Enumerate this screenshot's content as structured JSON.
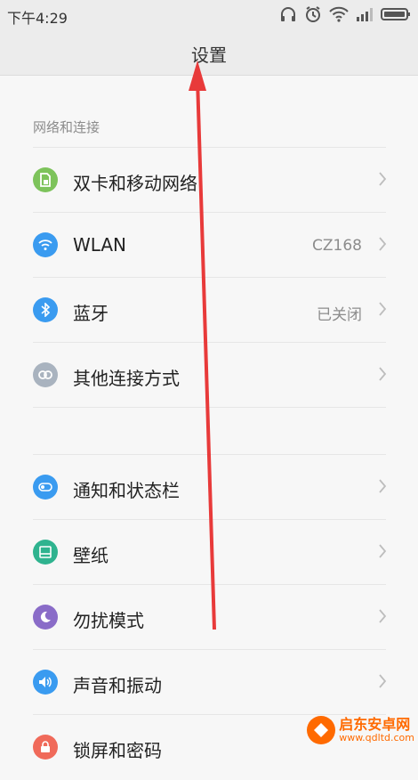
{
  "status_bar": {
    "time": "下午4:29"
  },
  "header": {
    "title": "设置"
  },
  "section_network": {
    "header": "网络和连接",
    "items": [
      {
        "label": "双卡和移动网络",
        "value": "",
        "icon": "sim-icon",
        "color": "#7dc35b"
      },
      {
        "label": "WLAN",
        "value": "CZ168",
        "icon": "wifi-icon",
        "color": "#3a9bf0"
      },
      {
        "label": "蓝牙",
        "value": "已关闭",
        "icon": "bluetooth-icon",
        "color": "#3a9bf0"
      },
      {
        "label": "其他连接方式",
        "value": "",
        "icon": "link-icon",
        "color": "#a9b3bf"
      }
    ]
  },
  "section_personal": {
    "items": [
      {
        "label": "通知和状态栏",
        "value": "",
        "icon": "notification-icon",
        "color": "#3a9bf0"
      },
      {
        "label": "壁纸",
        "value": "",
        "icon": "wallpaper-icon",
        "color": "#2fb38f"
      },
      {
        "label": "勿扰模式",
        "value": "",
        "icon": "moon-icon",
        "color": "#8a6cc8"
      },
      {
        "label": "声音和振动",
        "value": "",
        "icon": "speaker-icon",
        "color": "#3a9bf0"
      },
      {
        "label": "锁屏和密码",
        "value": "",
        "icon": "lock-icon",
        "color": "#f06a5a"
      }
    ]
  },
  "watermark": {
    "title": "启东安卓网",
    "url": "www.qdltd.com"
  },
  "annotation": {
    "color": "#e83a3a"
  }
}
